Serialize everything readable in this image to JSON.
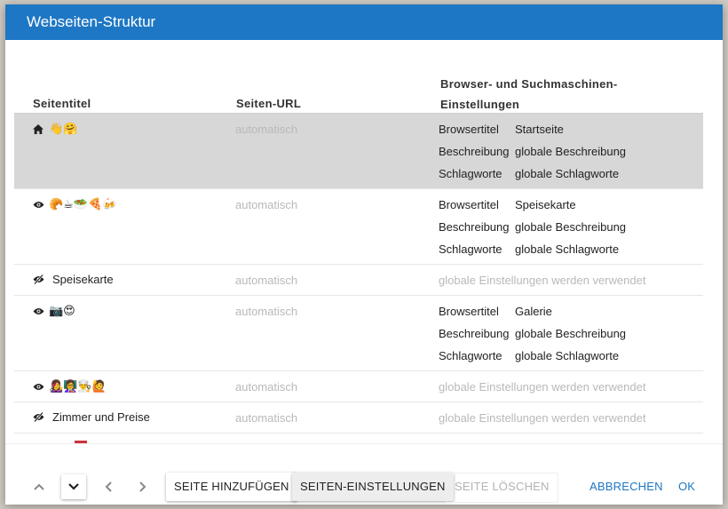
{
  "dialog": {
    "title": "Webseiten-Struktur",
    "accent_color": "#1e77c4"
  },
  "columns": {
    "page_title": "Seitentitel",
    "page_url": "Seiten-URL",
    "settings": "Browser- und Suchmaschinen-Einstellungen"
  },
  "rows": [
    {
      "icon": "home-icon",
      "emojis": "👋🤗",
      "name": "",
      "url": "automatisch",
      "browsertitel_label": "Browsertitel",
      "browsertitel": "Startseite",
      "beschreibung_label": "Beschreibung",
      "beschreibung": "globale Beschreibung",
      "schlagworte_label": "Schlagworte",
      "schlagworte": "globale Schlagworte",
      "selected": true
    },
    {
      "icon": "eye-icon",
      "emojis": "🥐☕🥗🍕🍻",
      "name": "",
      "url": "automatisch",
      "browsertitel_label": "Browsertitel",
      "browsertitel": "Speisekarte",
      "beschreibung_label": "Beschreibung",
      "beschreibung": "globale Beschreibung",
      "schlagworte_label": "Schlagworte",
      "schlagworte": "globale Schlagworte"
    },
    {
      "icon": "eye-off-icon",
      "name": "Speisekarte",
      "url": "automatisch",
      "global_settings": "globale Einstellungen werden verwendet"
    },
    {
      "icon": "eye-icon",
      "emojis": "📷😍",
      "name": "",
      "url": "automatisch",
      "browsertitel_label": "Browsertitel",
      "browsertitel": "Galerie",
      "beschreibung_label": "Beschreibung",
      "beschreibung": "globale Beschreibung",
      "schlagworte_label": "Schlagworte",
      "schlagworte": "globale Schlagworte"
    },
    {
      "icon": "eye-icon",
      "emojis": "👩‍🎤👩‍🏫👨‍🍳🙋",
      "name": "",
      "url": "automatisch",
      "global_settings": "globale Einstellungen werden verwendet"
    },
    {
      "icon": "eye-off-icon",
      "name": "Zimmer und Preise",
      "url": "automatisch",
      "global_settings": "globale Einstellungen werden verwendet"
    }
  ],
  "footer": {
    "move_up_icon": "chevron-up-icon",
    "move_down_icon": "chevron-down-icon",
    "outdent_icon": "chevron-left-icon",
    "indent_icon": "chevron-right-icon",
    "add_page": "Seite hinzufügen",
    "page_settings": "Seiten-Einstellungen",
    "delete_page": "Seite löschen",
    "cancel": "Abbrechen",
    "ok": "OK"
  }
}
